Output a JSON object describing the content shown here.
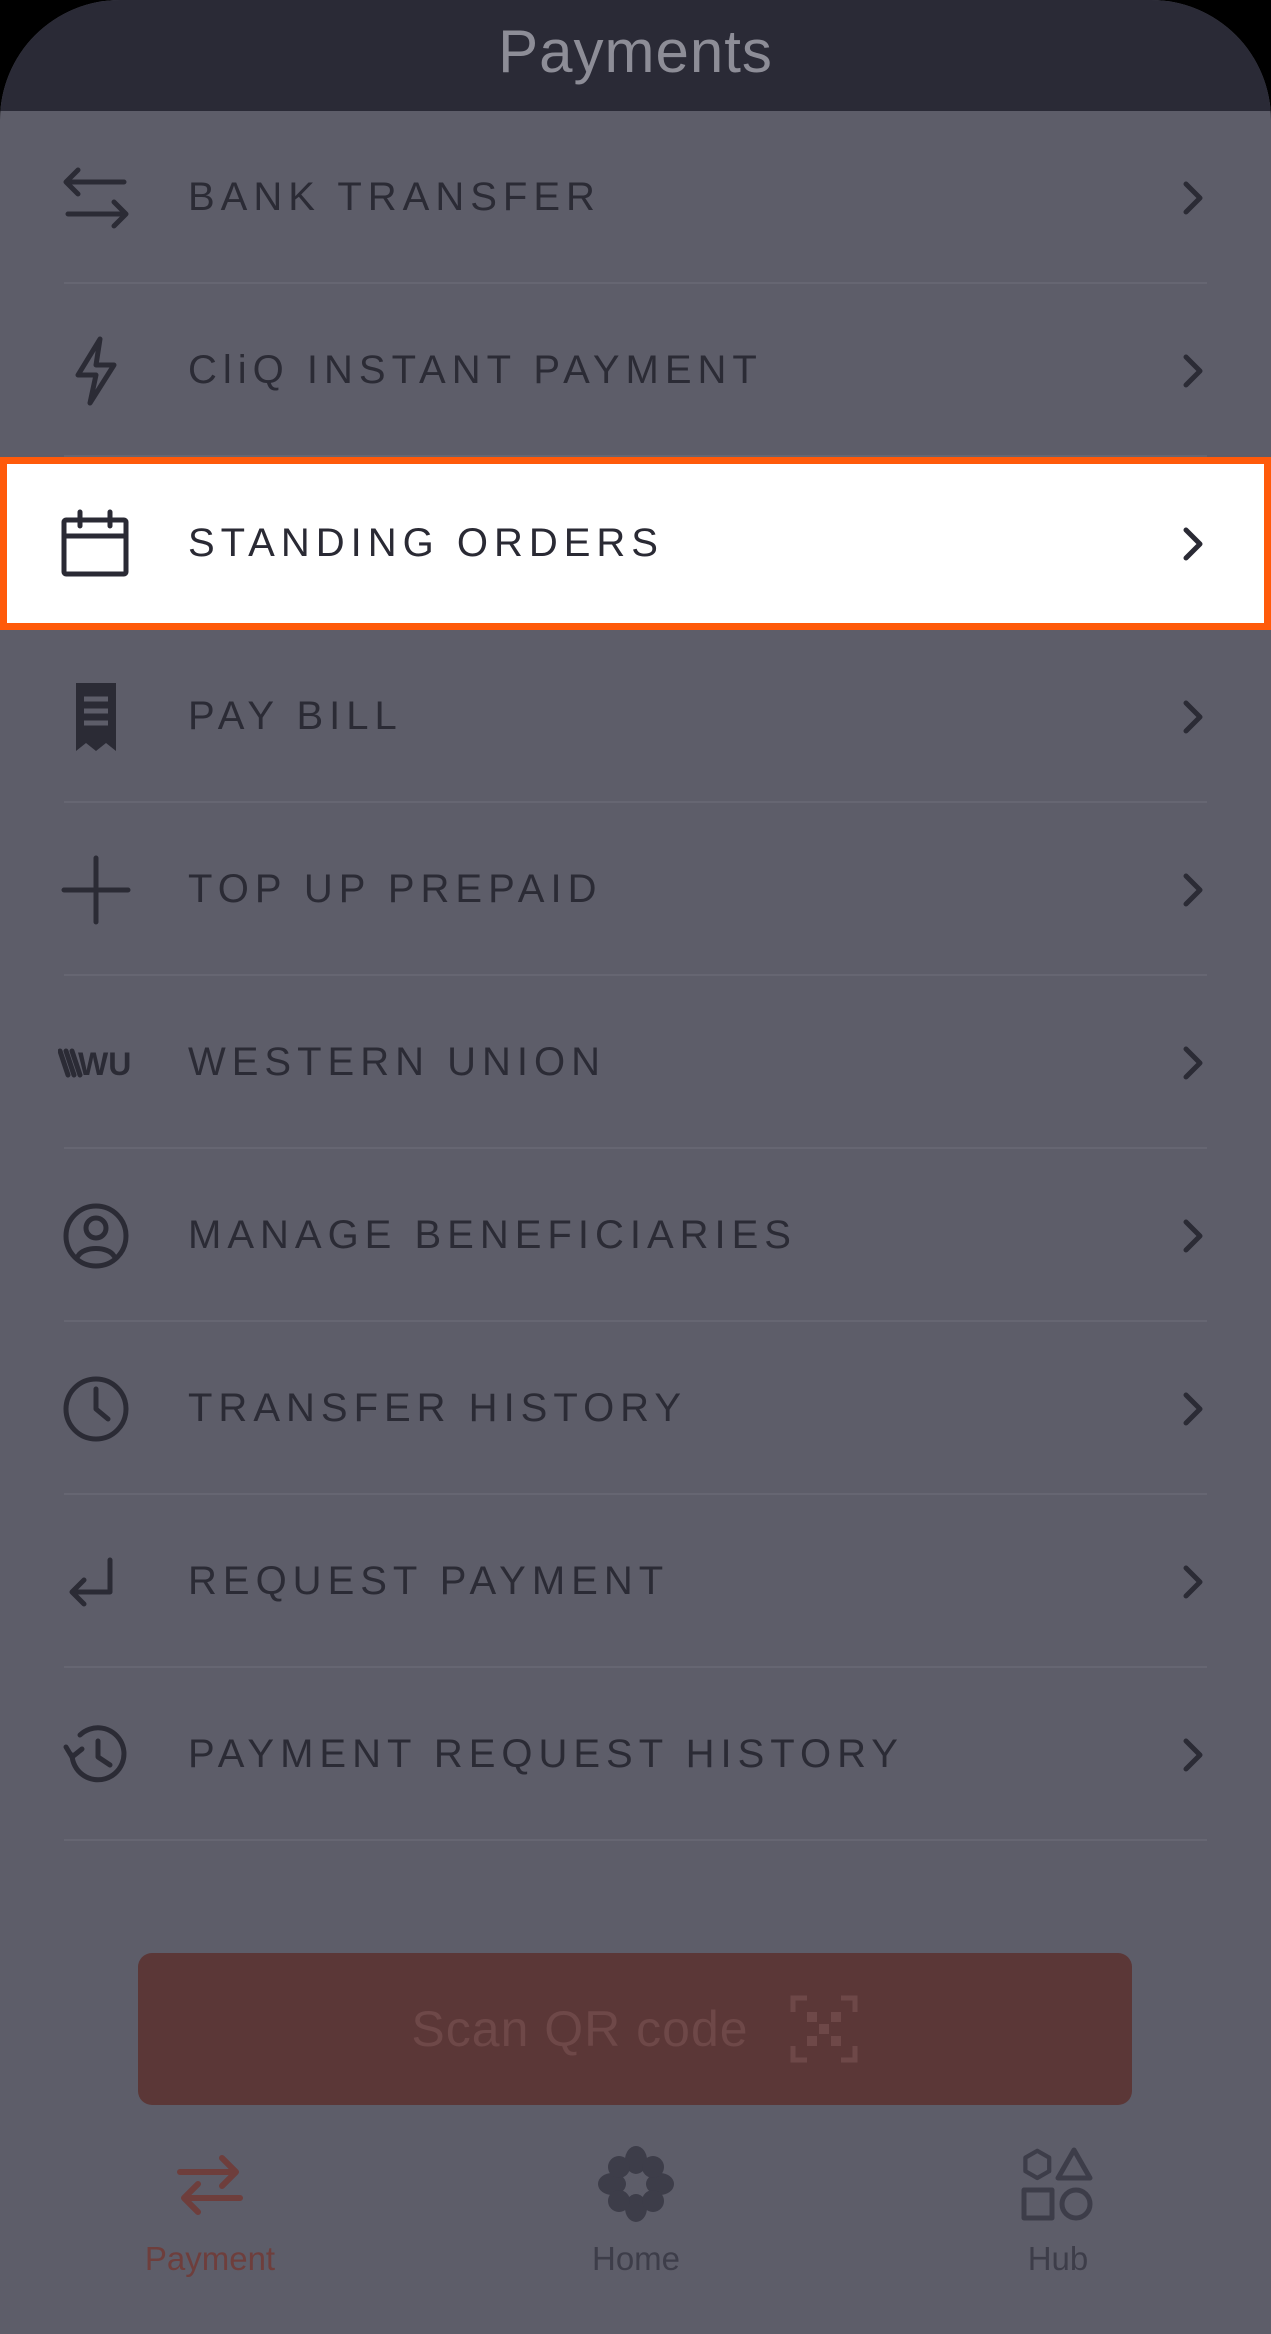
{
  "header": {
    "title": "Payments"
  },
  "menu": {
    "items": [
      {
        "label": "BANK TRANSFER",
        "icon": "transfer-arrows-icon"
      },
      {
        "label": "CliQ INSTANT PAYMENT",
        "icon": "lightning-icon"
      },
      {
        "label": "STANDING ORDERS",
        "icon": "calendar-icon",
        "highlighted": true
      },
      {
        "label": "PAY BILL",
        "icon": "receipt-icon"
      },
      {
        "label": "TOP UP PREPAID",
        "icon": "plus-icon"
      },
      {
        "label": "WESTERN UNION",
        "icon": "western-union-logo-icon",
        "logo_text": "WU"
      },
      {
        "label": "MANAGE BENEFICIARIES",
        "icon": "user-circle-icon"
      },
      {
        "label": "TRANSFER HISTORY",
        "icon": "clock-icon"
      },
      {
        "label": "REQUEST PAYMENT",
        "icon": "return-arrow-icon"
      },
      {
        "label": "PAYMENT REQUEST HISTORY",
        "icon": "history-icon"
      }
    ]
  },
  "qr_button": {
    "label": "Scan QR code",
    "icon": "qr-scan-icon"
  },
  "tabbar": {
    "tabs": [
      {
        "label": "Payment",
        "icon": "payment-arrows-icon",
        "active": true
      },
      {
        "label": "Home",
        "icon": "flower-logo-icon"
      },
      {
        "label": "Hub",
        "icon": "shapes-icon"
      }
    ]
  },
  "colors": {
    "background": "#5d5d69",
    "header": "#2a2a36",
    "highlight_border": "#ff5a0a",
    "qr_button": "#5b3737",
    "active_tab": "#6e3e3c"
  }
}
